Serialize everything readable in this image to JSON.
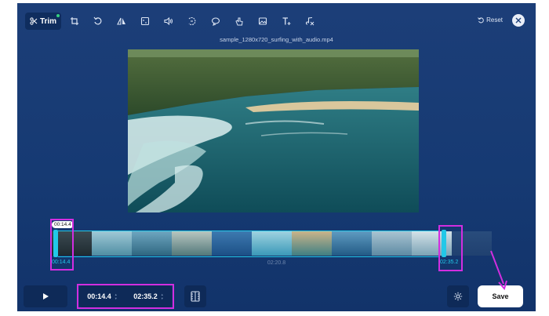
{
  "toolbar": {
    "trim_label": "Trim",
    "tools": [
      "crop-icon",
      "rotate-icon",
      "flip-icon",
      "aspect-ratio-icon",
      "volume-icon",
      "speed-icon",
      "loop-icon",
      "gif-icon",
      "image-icon",
      "add-text-icon",
      "remove-audio-icon"
    ],
    "reset_label": "Reset"
  },
  "video": {
    "filename": "sample_1280x720_surfing_with_audio.mp4"
  },
  "timeline": {
    "start_tip": "00:14.4",
    "start_label": "00:14.4",
    "end_label": "02:35.2",
    "center_label": "02:20.8"
  },
  "controls": {
    "start_time": "00:14.4",
    "end_time": "02:35.2",
    "save_label": "Save"
  },
  "colors": {
    "accent": "#22c8e8",
    "highlight": "#d22ee0",
    "background": "#163a73"
  }
}
